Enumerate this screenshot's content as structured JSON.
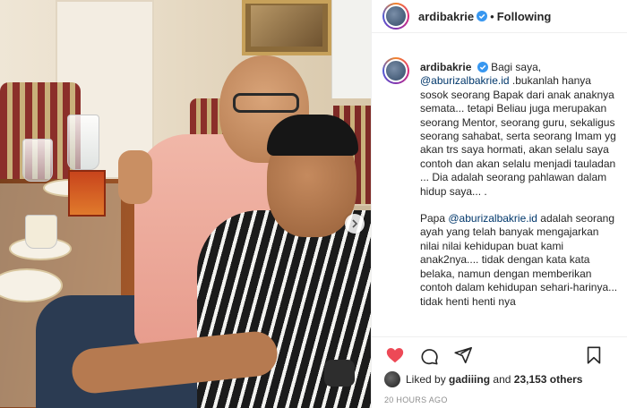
{
  "post": {
    "username": "ardibakrie",
    "follow_separator": "•",
    "follow_status": "Following"
  },
  "caption": {
    "username": "ardibakrie",
    "p1_a": "Bagi saya,",
    "p1_mention": "@aburizalbakrie.id",
    "p1_b": ".bukanlah hanya sosok seorang Bapak dari anak anaknya semata... tetapi Beliau juga merupakan seorang Mentor, seorang guru, sekaligus seorang sahabat, serta seorang Imam yg akan trs saya hormati, akan selalu saya contoh dan akan selalu menjadi tauladan ... Dia adalah seorang pahlawan dalam hidup saya... .",
    "p2_a": "Papa",
    "p2_mention": "@aburizalbakrie.id",
    "p2_b": "adalah seorang ayah yang telah banyak mengajarkan nilai nilai kehidupan buat kami anak2nya.... tidak dengan kata kata belaka, namun dengan memberikan contoh dalam kehidupan sehari-harinya... tidak henti henti nya"
  },
  "likes": {
    "prefix": "Liked by",
    "user": "gadiiing",
    "joiner": "and",
    "others": "23,153 others"
  },
  "timestamp": "20 HOURS AGO",
  "icons": {
    "like": "heart-filled-icon",
    "comment": "comment-icon",
    "share": "share-icon",
    "save": "bookmark-icon",
    "next": "chevron-right-icon",
    "verified": "verified-badge-icon"
  },
  "colors": {
    "like_red": "#ed4956",
    "verified_blue": "#3897f0",
    "mention_blue": "#00376b",
    "muted": "#8e8e8e"
  }
}
